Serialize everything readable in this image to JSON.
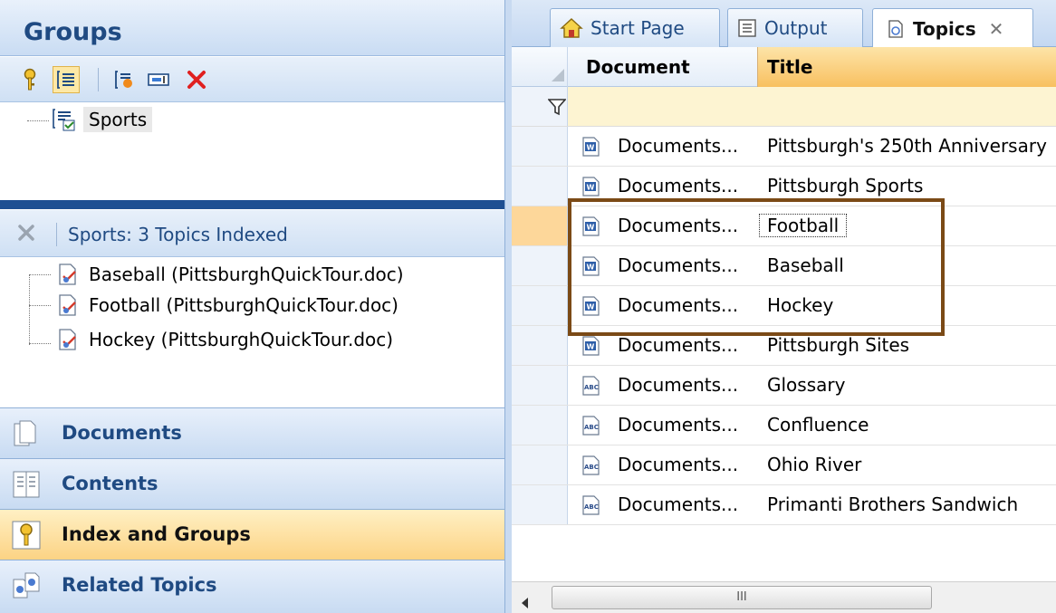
{
  "left": {
    "groups_title": "Groups",
    "groups_tree": [
      {
        "label": "Sports"
      }
    ],
    "index_status": "Sports: 3 Topics Indexed",
    "index_items": [
      {
        "label": "Baseball (PittsburghQuickTour.doc)"
      },
      {
        "label": "Football (PittsburghQuickTour.doc)"
      },
      {
        "label": "Hockey (PittsburghQuickTour.doc)"
      }
    ],
    "nav": [
      {
        "label": "Documents",
        "icon": "documents-icon",
        "active": false
      },
      {
        "label": "Contents",
        "icon": "contents-icon",
        "active": false
      },
      {
        "label": "Index and Groups",
        "icon": "key-icon",
        "active": true
      },
      {
        "label": "Related Topics",
        "icon": "related-topics-icon",
        "active": false
      }
    ]
  },
  "right": {
    "tabs": [
      {
        "label": "Start Page",
        "icon": "home-icon"
      },
      {
        "label": "Output",
        "icon": "output-icon"
      },
      {
        "label": "Topics",
        "icon": "topics-icon",
        "active": true,
        "close": "✕"
      }
    ],
    "columns": {
      "document": "Document",
      "title": "Title"
    },
    "rows": [
      {
        "doc": "Documents...",
        "title": "Pittsburgh's 250th Anniversary",
        "type": "word"
      },
      {
        "doc": "Documents...",
        "title": "Pittsburgh Sports",
        "type": "word"
      },
      {
        "doc": "Documents...",
        "title": "Football",
        "type": "word",
        "current": true
      },
      {
        "doc": "Documents...",
        "title": "Baseball",
        "type": "word"
      },
      {
        "doc": "Documents...",
        "title": "Hockey",
        "type": "word"
      },
      {
        "doc": "Documents...",
        "title": "Pittsburgh Sites",
        "type": "word"
      },
      {
        "doc": "Documents...",
        "title": "Glossary",
        "type": "abc"
      },
      {
        "doc": "Documents...",
        "title": "Confluence",
        "type": "abc"
      },
      {
        "doc": "Documents...",
        "title": "Ohio River",
        "type": "abc"
      },
      {
        "doc": "Documents...",
        "title": "Primanti Brothers Sandwich",
        "type": "abc"
      }
    ],
    "scroll_thumb": "III"
  },
  "colors": {
    "accent": "#1f4a82",
    "highlight": "#7b4a16",
    "active_nav": "#fcd384"
  }
}
